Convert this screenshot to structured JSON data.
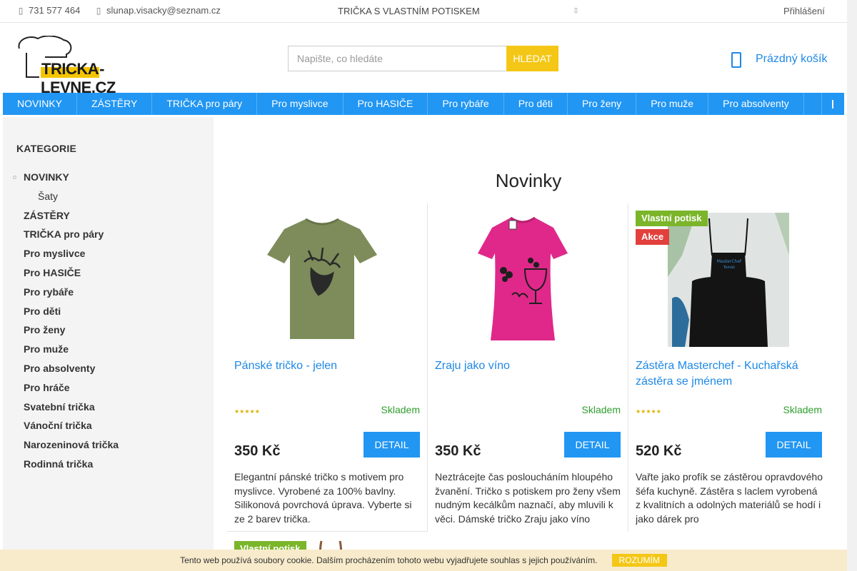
{
  "topbar": {
    "phone": "731 577 464",
    "email": "slunap.visacky@seznam.cz",
    "banner": "TRIČKA S VLASTNÍM POTISKEM",
    "login": "Přihlášení"
  },
  "header": {
    "logo_text_highlight": "TRICKA",
    "logo_text_rest": "-LEVNE.CZ",
    "search_placeholder": "Napište, co hledáte",
    "search_button": "HLEDAT",
    "cart_label": "Prázdný košík"
  },
  "nav": {
    "items": [
      "NOVINKY",
      "ZÁSTĚRY",
      "TRIČKA pro páry",
      "Pro myslivce",
      "Pro HASIČE",
      "Pro rybáře",
      "Pro děti",
      "Pro ženy",
      "Pro muže",
      "Pro absolventy"
    ]
  },
  "sidebar": {
    "title": "KATEGORIE",
    "items": [
      {
        "label": "NOVINKY"
      },
      {
        "label": "Šaty"
      },
      {
        "label": "ZÁSTĚRY"
      },
      {
        "label": "TRIČKA pro páry"
      },
      {
        "label": "Pro myslivce"
      },
      {
        "label": "Pro HASIČE"
      },
      {
        "label": "Pro rybáře"
      },
      {
        "label": "Pro děti"
      },
      {
        "label": "Pro ženy"
      },
      {
        "label": "Pro muže"
      },
      {
        "label": "Pro absolventy"
      },
      {
        "label": "Pro hráče"
      },
      {
        "label": "Svatební trička"
      },
      {
        "label": "Vánoční trička"
      },
      {
        "label": "Narozeninová trička"
      },
      {
        "label": "Rodinná trička"
      }
    ]
  },
  "main": {
    "heading": "Novinky",
    "products": [
      {
        "name": "Pánské tričko - jelen",
        "stars": "★★★★★",
        "stock": "Skladem",
        "price": "350 Kč",
        "detail": "DETAIL",
        "description": "Elegantní pánské tričko s motivem pro myslivce. Vyrobené za 100% bavlny. Silikonová povrchová úprava. Vyberte si ze 2 barev trička."
      },
      {
        "name": "Zraju jako víno",
        "stars": "",
        "stock": "Skladem",
        "price": "350 Kč",
        "detail": "DETAIL",
        "description": "Neztrácejte čas posloucháním hloupého žvanění. Tričko s potiskem pro ženy všem nudným kecálkům naznačí, aby mluvili k věci. Dámské tričko Zraju jako víno"
      },
      {
        "name": "Zástěra Masterchef - Kuchařská zástěra se jménem",
        "badges": [
          "Vlastní potisk",
          "Akce"
        ],
        "stars": "★★★★★",
        "stock": "Skladem",
        "price": "520 Kč",
        "detail": "DETAIL",
        "description": "Vařte jako profík se zástěrou opravdového šéfa kuchyně. Zástěra s laclem vyrobená z kvalitních a odolných materiálů se hodí i jako dárek pro"
      }
    ],
    "peek_badge": "Vlastní potisk"
  },
  "cookie": {
    "text": "Tento web používá soubory cookie. Dalším procházením tohoto webu vyjadřujete souhlas s jejich používáním.",
    "button": "ROZUMÍM"
  },
  "colors": {
    "accent": "#2196f3",
    "yellow": "#f4c716",
    "green_badge": "#7bb52a",
    "red_badge": "#e2403c",
    "stock_green": "#2e9e2e"
  }
}
